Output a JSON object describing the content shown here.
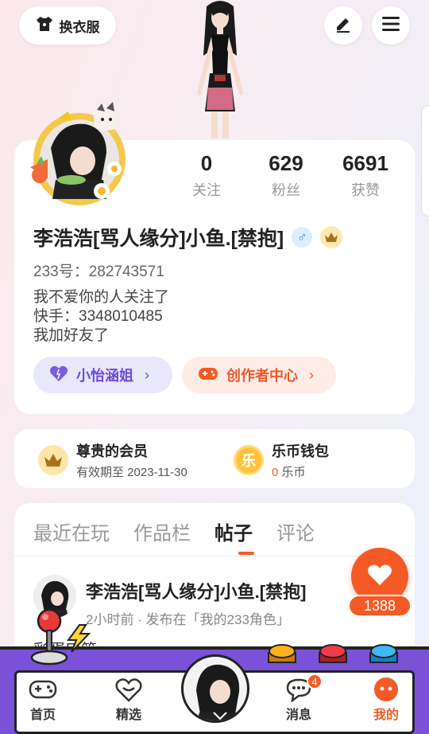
{
  "topbar": {
    "outfit_label": "换衣服"
  },
  "stats": [
    {
      "value": "0",
      "label": "关注"
    },
    {
      "value": "629",
      "label": "粉丝"
    },
    {
      "value": "6691",
      "label": "获赞"
    }
  ],
  "profile": {
    "username": "李浩浩[骂人缘分]小鱼.[禁抱]",
    "gender_symbol": "♂",
    "uid": "233号：282743571",
    "bio": [
      "我不爱你的人关注了",
      "快手：3348010485",
      "我加好友了"
    ]
  },
  "pills": {
    "fav_label": "小怡涵姐",
    "create_label": "创作者中心"
  },
  "vip": {
    "member_title": "尊贵的会员",
    "member_sub": "有效期至 2023-11-30",
    "wallet_title": "乐币钱包",
    "wallet_amount": "0",
    "wallet_unit": "乐币",
    "wallet_icon_char": "乐"
  },
  "tabs": [
    "最近在玩",
    "作品栏",
    "帖子",
    "评论"
  ],
  "active_tab": "帖子",
  "post": {
    "author": "李浩浩[骂人缘分]小鱼.[禁抱]",
    "meta": "2小时前 · 发布在「我的233角色」",
    "text": "彩蛋口第"
  },
  "like": {
    "count": "1388"
  },
  "nav": {
    "home": "首页",
    "featured": "精选",
    "messages": "消息",
    "messages_badge": "4",
    "mine": "我的"
  },
  "colors": {
    "accent": "#f55a26",
    "purple": "#7a52d8",
    "fav": "#6a4ae0"
  }
}
